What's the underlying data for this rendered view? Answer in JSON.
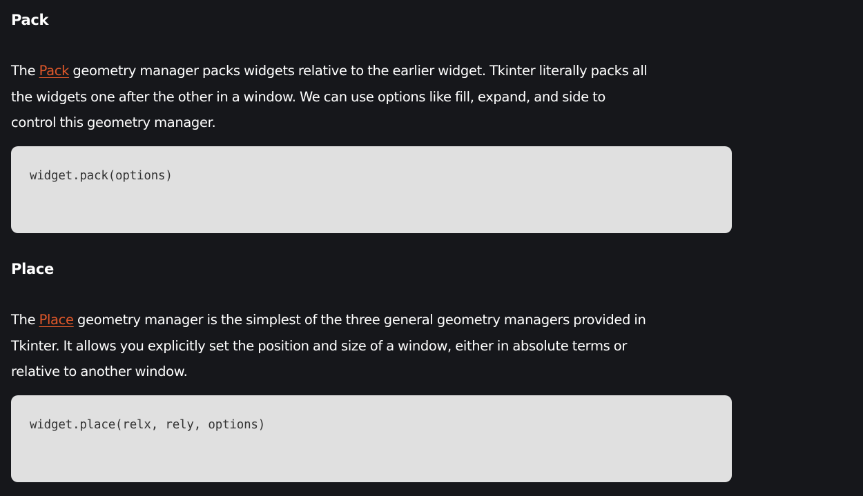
{
  "sections": [
    {
      "heading": "Pack",
      "para_prefix": "The ",
      "link_text": "Pack",
      "para_line1": " geometry manager packs widgets relative to the earlier widget. Tkinter literally packs all",
      "para_line2": "the widgets one after the other in a window. We can use options like fill, expand, and side to",
      "para_line3": "control this geometry manager.",
      "code": "widget.pack(options)"
    },
    {
      "heading": "Place",
      "para_prefix": "The ",
      "link_text": "Place",
      "para_line1": " geometry manager is the simplest of the three general geometry managers provided in",
      "para_line2": "Tkinter. It allows you explicitly set the position and size of a window, either in absolute terms or",
      "para_line3": "relative to another window.",
      "code": "widget.place(relx, rely, options)"
    }
  ],
  "colors": {
    "background": "#16171b",
    "text": "#ffffff",
    "link": "#e0582a",
    "code_background": "#e0e0e0",
    "code_text": "#333333"
  }
}
